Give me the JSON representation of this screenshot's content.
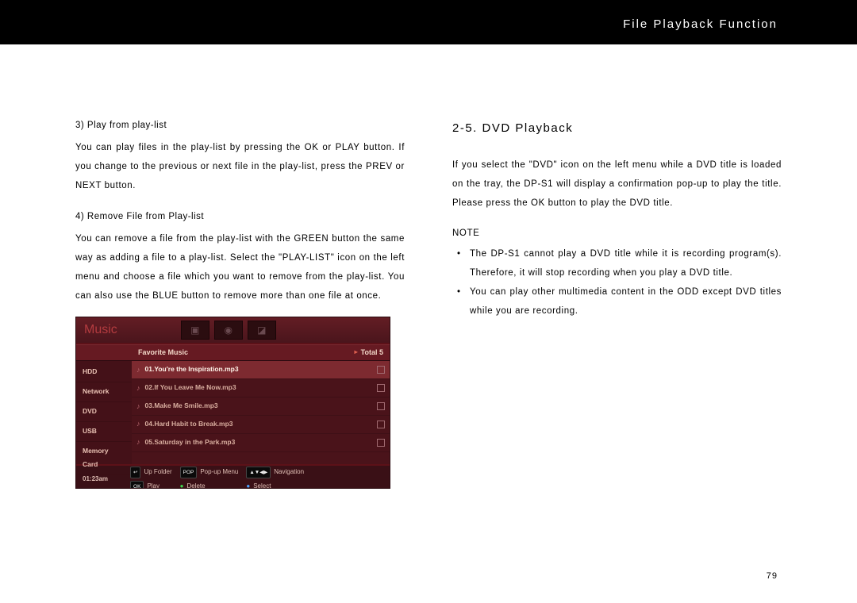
{
  "header": {
    "title": "File Playback Function"
  },
  "left": {
    "sub3": "3) Play from play-list",
    "para3": "You can play files in the play-list by pressing the OK or PLAY button. If you change to the previous or next file in the play-list, press the PREV or NEXT button.",
    "sub4": "4) Remove File from Play-list",
    "para4": "You can remove a file from the play-list with the GREEN button the same way as adding a file to a play-list. Select the \"PLAY-LIST\" icon on the left menu and choose a file which you want to remove from the play-list. You can also use the BLUE button to remove more than one file at once."
  },
  "right": {
    "section_title": "2-5. DVD Playback",
    "para1": "If you select the \"DVD\" icon on the left menu while a DVD title is loaded on the tray, the DP-S1 will display a confirmation pop-up to play the title. Please press the OK button to play the DVD title.",
    "note_label": "NOTE",
    "note1": "The DP-S1 cannot play a DVD title while it is recording program(s). Therefore, it will stop recording when you play a DVD title.",
    "note2": "You can play other multimedia content in the ODD except DVD titles while you are recording."
  },
  "page_number": "79",
  "screenshot": {
    "tab_label": "Music",
    "list_title": "Favorite Music",
    "total_label": "Total 5",
    "sidebar": [
      "HDD",
      "Network",
      "DVD",
      "USB",
      "Memory Card"
    ],
    "files": [
      {
        "name": "01.You're the Inspiration.mp3",
        "selected": true
      },
      {
        "name": "02.If You Leave Me Now.mp3",
        "selected": false
      },
      {
        "name": "03.Make Me Smile.mp3",
        "selected": false
      },
      {
        "name": "04.Hard Habit to Break.mp3",
        "selected": false
      },
      {
        "name": "05.Saturday in the Park.mp3",
        "selected": false
      }
    ],
    "time": "01:23am",
    "footer": {
      "up_folder": "Up Folder",
      "play": "Play",
      "popup": "Pop-up Menu",
      "delete": "Delete",
      "nav": "Navigation",
      "select": "Select"
    }
  }
}
